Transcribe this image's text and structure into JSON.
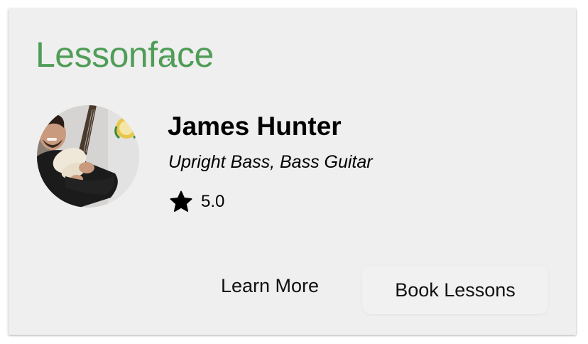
{
  "brand": {
    "logo_text_before": "Lessonf",
    "logo_text_face": "a",
    "logo_text_after": "ce",
    "color": "#4f9d57"
  },
  "teacher": {
    "name": "James Hunter",
    "instruments": "Upright Bass, Bass Guitar",
    "rating": "5.0",
    "rating_icon": "star-icon"
  },
  "actions": {
    "learn_more_label": "Learn More",
    "book_lessons_label": "Book Lessons"
  },
  "colors": {
    "card_background": "#efefef",
    "text": "#000000"
  }
}
